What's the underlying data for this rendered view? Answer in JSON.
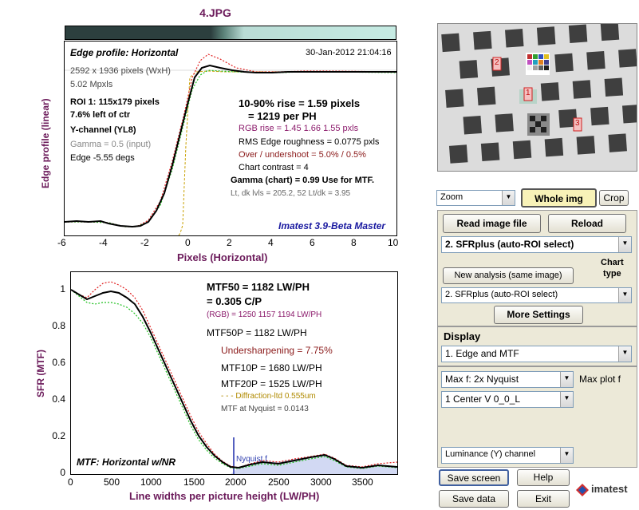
{
  "window_title": "4.JPG",
  "edge_plot": {
    "heading": "Edge profile: Horizontal",
    "date": "30-Jan-2012 21:04:16",
    "image_size": "2592 x 1936 pixels (WxH)",
    "mpxls": "5.02 Mpxls",
    "roi": "ROI 1:  115x179 pixels",
    "roi_pos": "7.6% left of ctr",
    "channel": "Y-channel  (YL8)",
    "gamma_input": "Gamma = 0.5 (input)",
    "edge_angle": "Edge -5.55 degs",
    "rise": "10-90% rise = 1.59 pixels",
    "rise_ph": "= 1219 per PH",
    "rgb_rise": "RGB rise = 1.45  1.66  1.55 pxls",
    "rms": "RMS Edge roughness = 0.0775 pxls",
    "overshoot": "Over / undershoot = 5.0% / 0.5%",
    "contrast": "Chart contrast = 4",
    "gamma_chart": "Gamma (chart) = 0.99  Use for MTF.",
    "levels": "Lt, dk lvls = 205.2, 52   Lt/dk = 3.95",
    "footer": "Imatest 3.9-Beta Master",
    "y_label": "Edge profile (linear)",
    "x_label": "Pixels (Horizontal)",
    "x_ticks": [
      "-6",
      "-4",
      "-2",
      "0",
      "2",
      "4",
      "6",
      "8",
      "10"
    ]
  },
  "mtf_plot": {
    "mtf50": "MTF50 = 1182 LW/PH",
    "cp": "= 0.305 C/P",
    "rgb": "(RGB) = 1250  1157  1194 LW/PH",
    "mtf50p": "MTF50P = 1182 LW/PH",
    "undersharp": "Undersharpening = 7.75%",
    "mtf10p": "MTF10P = 1680 LW/PH",
    "mtf20p": "MTF20P = 1525 LW/PH",
    "diffraction": "- - - Diffraction-ltd  0.555um",
    "nyquist_val": "MTF at Nyquist = 0.0143",
    "nyquist_label": "Nyquist f",
    "footer": "MTF: Horizontal w/NR",
    "y_label": "SFR (MTF)",
    "x_label": "Line widths per picture height (LW/PH)",
    "x_ticks": [
      "0",
      "500",
      "1000",
      "1500",
      "2000",
      "2500",
      "3000",
      "3500"
    ],
    "y_ticks": [
      "1",
      "0.8",
      "0.6",
      "0.4",
      "0.2",
      "0"
    ]
  },
  "chart_data": [
    {
      "type": "line",
      "title": "Edge profile: Horizontal",
      "xlabel": "Pixels (Horizontal)",
      "ylabel": "Edge profile (linear)",
      "xlim": [
        -6,
        10
      ],
      "ylim": [
        0,
        1
      ],
      "x": [
        -6,
        -5,
        -4,
        -3,
        -2.5,
        -2,
        -1.5,
        -1,
        -0.5,
        0,
        0.5,
        1,
        1.5,
        2,
        3,
        4,
        6,
        8,
        10
      ],
      "series": [
        {
          "values": [
            0.09,
            0.09,
            0.08,
            0.06,
            0.06,
            0.1,
            0.24,
            0.45,
            0.65,
            0.82,
            0.93,
            0.97,
            0.96,
            0.93,
            0.91,
            0.92,
            0.91,
            0.91,
            0.92
          ]
        },
        {
          "values": [
            0.09,
            0.09,
            0.08,
            0.06,
            0.06,
            0.1,
            0.25,
            0.47,
            0.68,
            0.87,
            0.99,
            1.0,
            0.98,
            0.95,
            0.92,
            0.92,
            0.92,
            0.92,
            0.92
          ]
        },
        {
          "values": [
            0.09,
            0.09,
            0.08,
            0.06,
            0.06,
            0.1,
            0.23,
            0.43,
            0.62,
            0.79,
            0.89,
            0.93,
            0.94,
            0.92,
            0.91,
            0.91,
            0.91,
            0.91,
            0.91
          ]
        }
      ]
    },
    {
      "type": "line",
      "title": "MTF: Horizontal w/NR",
      "xlabel": "Line widths per picture height (LW/PH)",
      "ylabel": "SFR (MTF)",
      "xlim": [
        0,
        3880
      ],
      "ylim": [
        0,
        1.1
      ],
      "x": [
        0,
        200,
        400,
        600,
        800,
        1000,
        1200,
        1400,
        1600,
        1800,
        1940,
        2200,
        2400,
        2600,
        2800,
        3000,
        3200,
        3400,
        3600,
        3880
      ],
      "series": [
        {
          "values": [
            1.0,
            0.93,
            0.96,
            0.95,
            0.86,
            0.68,
            0.49,
            0.31,
            0.15,
            0.05,
            0.02,
            0.06,
            0.09,
            0.06,
            0.08,
            0.1,
            0.06,
            0.03,
            0.04,
            0.02
          ]
        },
        {
          "values": [
            1.0,
            0.95,
            1.01,
            1.02,
            0.92,
            0.73,
            0.53,
            0.34,
            0.17,
            0.06,
            0.02,
            0.06,
            0.09,
            0.06,
            0.08,
            0.11,
            0.07,
            0.03,
            0.05,
            0.03
          ]
        },
        {
          "values": [
            1.0,
            0.9,
            0.91,
            0.9,
            0.82,
            0.65,
            0.47,
            0.29,
            0.14,
            0.05,
            0.02,
            0.05,
            0.08,
            0.05,
            0.08,
            0.09,
            0.06,
            0.03,
            0.04,
            0.02
          ]
        }
      ]
    }
  ],
  "controls": {
    "zoom_value": "Zoom",
    "whole_img": "Whole img",
    "crop": "Crop",
    "read_image": "Read image file",
    "reload": "Reload",
    "sfrplus": "2. SFRplus (auto-ROI select)",
    "chart_type": "Chart\ntype",
    "new_analysis": "New analysis (same image)",
    "chart_select": "2. SFRplus (auto-ROI select)",
    "more_settings": "More Settings",
    "display_label": "Display",
    "display_value": "1.  Edge and MTF",
    "maxf_value": "Max f:   2x Nyquist",
    "max_plot": "Max plot f",
    "roi_value": "1  Center   V     0_0_L",
    "channel_value": "Luminance (Y) channel",
    "save_screen": "Save screen",
    "help": "Help",
    "save_data": "Save data",
    "exit": "Exit",
    "logo": "imatest",
    "roi_markers": [
      "2",
      "1",
      "3"
    ]
  }
}
